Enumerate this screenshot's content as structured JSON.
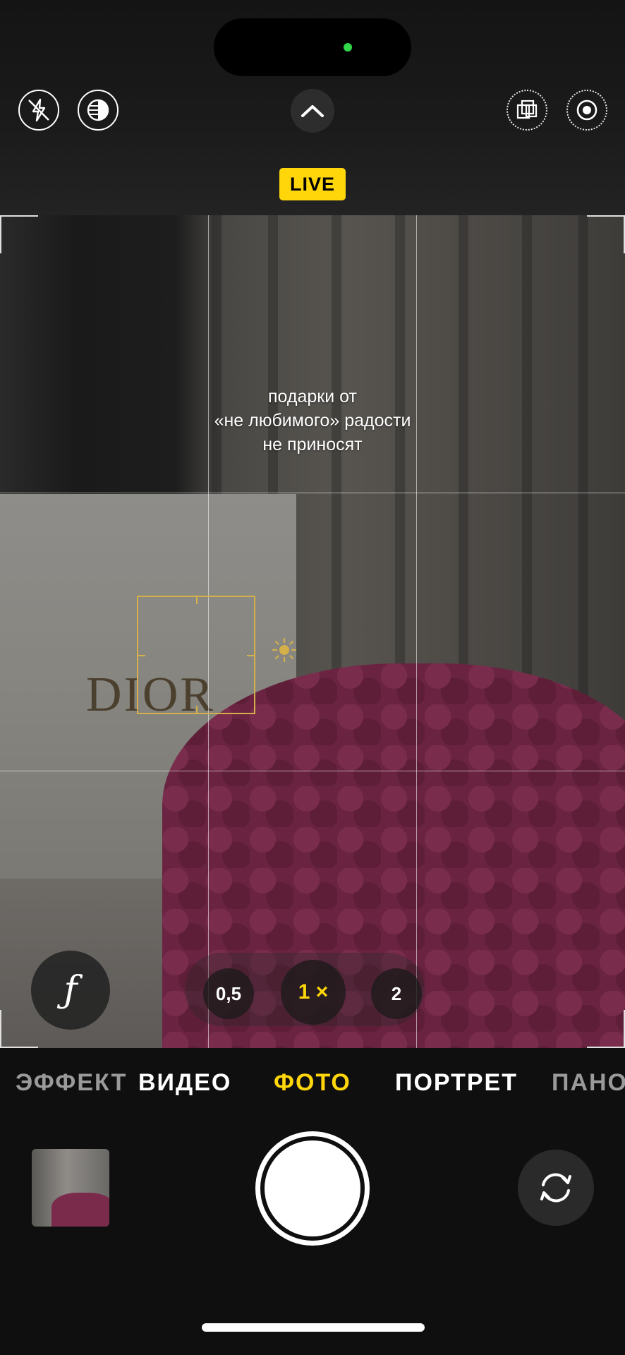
{
  "top_bar": {
    "live_label": "LIVE",
    "icons": {
      "flash": "flash-off-icon",
      "night": "night-mode-icon",
      "chevron": "chevron-up-icon",
      "styles": "photographic-styles-icon",
      "live_photo": "live-photo-icon"
    }
  },
  "viewfinder": {
    "caption_lines": [
      "подарки от",
      "«не любимого» радости",
      "не приносят"
    ],
    "scene_text": "DIOR",
    "aperture_label": "ƒ",
    "zoom": {
      "options": [
        "0,5",
        "1 ×",
        "2"
      ],
      "selected": "1 ×"
    }
  },
  "modes": {
    "items": [
      "ЭФФЕКТ",
      "ВИДЕО",
      "ФОТО",
      "ПОРТРЕТ",
      "ПАНО"
    ],
    "active": "ФОТО"
  },
  "colors": {
    "accent": "#ffd60a",
    "island_indicator": "#32d74b",
    "focus": "#d4b04a"
  }
}
